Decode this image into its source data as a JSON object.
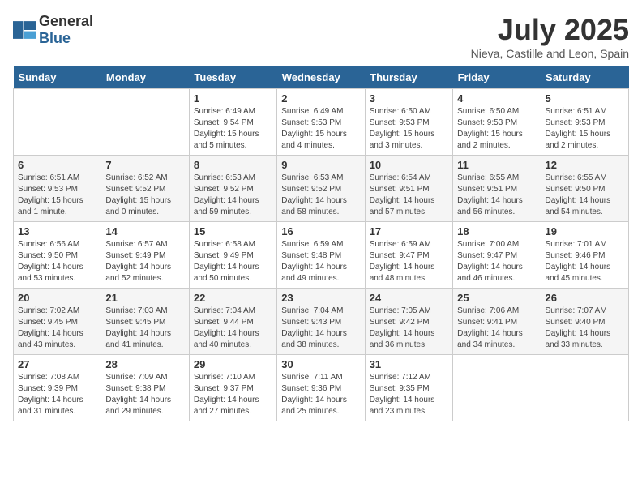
{
  "header": {
    "logo_general": "General",
    "logo_blue": "Blue",
    "month": "July 2025",
    "location": "Nieva, Castille and Leon, Spain"
  },
  "days_of_week": [
    "Sunday",
    "Monday",
    "Tuesday",
    "Wednesday",
    "Thursday",
    "Friday",
    "Saturday"
  ],
  "weeks": [
    [
      {
        "day": "",
        "sunrise": "",
        "sunset": "",
        "daylight": ""
      },
      {
        "day": "",
        "sunrise": "",
        "sunset": "",
        "daylight": ""
      },
      {
        "day": "1",
        "sunrise": "Sunrise: 6:49 AM",
        "sunset": "Sunset: 9:54 PM",
        "daylight": "Daylight: 15 hours and 5 minutes."
      },
      {
        "day": "2",
        "sunrise": "Sunrise: 6:49 AM",
        "sunset": "Sunset: 9:53 PM",
        "daylight": "Daylight: 15 hours and 4 minutes."
      },
      {
        "day": "3",
        "sunrise": "Sunrise: 6:50 AM",
        "sunset": "Sunset: 9:53 PM",
        "daylight": "Daylight: 15 hours and 3 minutes."
      },
      {
        "day": "4",
        "sunrise": "Sunrise: 6:50 AM",
        "sunset": "Sunset: 9:53 PM",
        "daylight": "Daylight: 15 hours and 2 minutes."
      },
      {
        "day": "5",
        "sunrise": "Sunrise: 6:51 AM",
        "sunset": "Sunset: 9:53 PM",
        "daylight": "Daylight: 15 hours and 2 minutes."
      }
    ],
    [
      {
        "day": "6",
        "sunrise": "Sunrise: 6:51 AM",
        "sunset": "Sunset: 9:53 PM",
        "daylight": "Daylight: 15 hours and 1 minute."
      },
      {
        "day": "7",
        "sunrise": "Sunrise: 6:52 AM",
        "sunset": "Sunset: 9:52 PM",
        "daylight": "Daylight: 15 hours and 0 minutes."
      },
      {
        "day": "8",
        "sunrise": "Sunrise: 6:53 AM",
        "sunset": "Sunset: 9:52 PM",
        "daylight": "Daylight: 14 hours and 59 minutes."
      },
      {
        "day": "9",
        "sunrise": "Sunrise: 6:53 AM",
        "sunset": "Sunset: 9:52 PM",
        "daylight": "Daylight: 14 hours and 58 minutes."
      },
      {
        "day": "10",
        "sunrise": "Sunrise: 6:54 AM",
        "sunset": "Sunset: 9:51 PM",
        "daylight": "Daylight: 14 hours and 57 minutes."
      },
      {
        "day": "11",
        "sunrise": "Sunrise: 6:55 AM",
        "sunset": "Sunset: 9:51 PM",
        "daylight": "Daylight: 14 hours and 56 minutes."
      },
      {
        "day": "12",
        "sunrise": "Sunrise: 6:55 AM",
        "sunset": "Sunset: 9:50 PM",
        "daylight": "Daylight: 14 hours and 54 minutes."
      }
    ],
    [
      {
        "day": "13",
        "sunrise": "Sunrise: 6:56 AM",
        "sunset": "Sunset: 9:50 PM",
        "daylight": "Daylight: 14 hours and 53 minutes."
      },
      {
        "day": "14",
        "sunrise": "Sunrise: 6:57 AM",
        "sunset": "Sunset: 9:49 PM",
        "daylight": "Daylight: 14 hours and 52 minutes."
      },
      {
        "day": "15",
        "sunrise": "Sunrise: 6:58 AM",
        "sunset": "Sunset: 9:49 PM",
        "daylight": "Daylight: 14 hours and 50 minutes."
      },
      {
        "day": "16",
        "sunrise": "Sunrise: 6:59 AM",
        "sunset": "Sunset: 9:48 PM",
        "daylight": "Daylight: 14 hours and 49 minutes."
      },
      {
        "day": "17",
        "sunrise": "Sunrise: 6:59 AM",
        "sunset": "Sunset: 9:47 PM",
        "daylight": "Daylight: 14 hours and 48 minutes."
      },
      {
        "day": "18",
        "sunrise": "Sunrise: 7:00 AM",
        "sunset": "Sunset: 9:47 PM",
        "daylight": "Daylight: 14 hours and 46 minutes."
      },
      {
        "day": "19",
        "sunrise": "Sunrise: 7:01 AM",
        "sunset": "Sunset: 9:46 PM",
        "daylight": "Daylight: 14 hours and 45 minutes."
      }
    ],
    [
      {
        "day": "20",
        "sunrise": "Sunrise: 7:02 AM",
        "sunset": "Sunset: 9:45 PM",
        "daylight": "Daylight: 14 hours and 43 minutes."
      },
      {
        "day": "21",
        "sunrise": "Sunrise: 7:03 AM",
        "sunset": "Sunset: 9:45 PM",
        "daylight": "Daylight: 14 hours and 41 minutes."
      },
      {
        "day": "22",
        "sunrise": "Sunrise: 7:04 AM",
        "sunset": "Sunset: 9:44 PM",
        "daylight": "Daylight: 14 hours and 40 minutes."
      },
      {
        "day": "23",
        "sunrise": "Sunrise: 7:04 AM",
        "sunset": "Sunset: 9:43 PM",
        "daylight": "Daylight: 14 hours and 38 minutes."
      },
      {
        "day": "24",
        "sunrise": "Sunrise: 7:05 AM",
        "sunset": "Sunset: 9:42 PM",
        "daylight": "Daylight: 14 hours and 36 minutes."
      },
      {
        "day": "25",
        "sunrise": "Sunrise: 7:06 AM",
        "sunset": "Sunset: 9:41 PM",
        "daylight": "Daylight: 14 hours and 34 minutes."
      },
      {
        "day": "26",
        "sunrise": "Sunrise: 7:07 AM",
        "sunset": "Sunset: 9:40 PM",
        "daylight": "Daylight: 14 hours and 33 minutes."
      }
    ],
    [
      {
        "day": "27",
        "sunrise": "Sunrise: 7:08 AM",
        "sunset": "Sunset: 9:39 PM",
        "daylight": "Daylight: 14 hours and 31 minutes."
      },
      {
        "day": "28",
        "sunrise": "Sunrise: 7:09 AM",
        "sunset": "Sunset: 9:38 PM",
        "daylight": "Daylight: 14 hours and 29 minutes."
      },
      {
        "day": "29",
        "sunrise": "Sunrise: 7:10 AM",
        "sunset": "Sunset: 9:37 PM",
        "daylight": "Daylight: 14 hours and 27 minutes."
      },
      {
        "day": "30",
        "sunrise": "Sunrise: 7:11 AM",
        "sunset": "Sunset: 9:36 PM",
        "daylight": "Daylight: 14 hours and 25 minutes."
      },
      {
        "day": "31",
        "sunrise": "Sunrise: 7:12 AM",
        "sunset": "Sunset: 9:35 PM",
        "daylight": "Daylight: 14 hours and 23 minutes."
      },
      {
        "day": "",
        "sunrise": "",
        "sunset": "",
        "daylight": ""
      },
      {
        "day": "",
        "sunrise": "",
        "sunset": "",
        "daylight": ""
      }
    ]
  ]
}
